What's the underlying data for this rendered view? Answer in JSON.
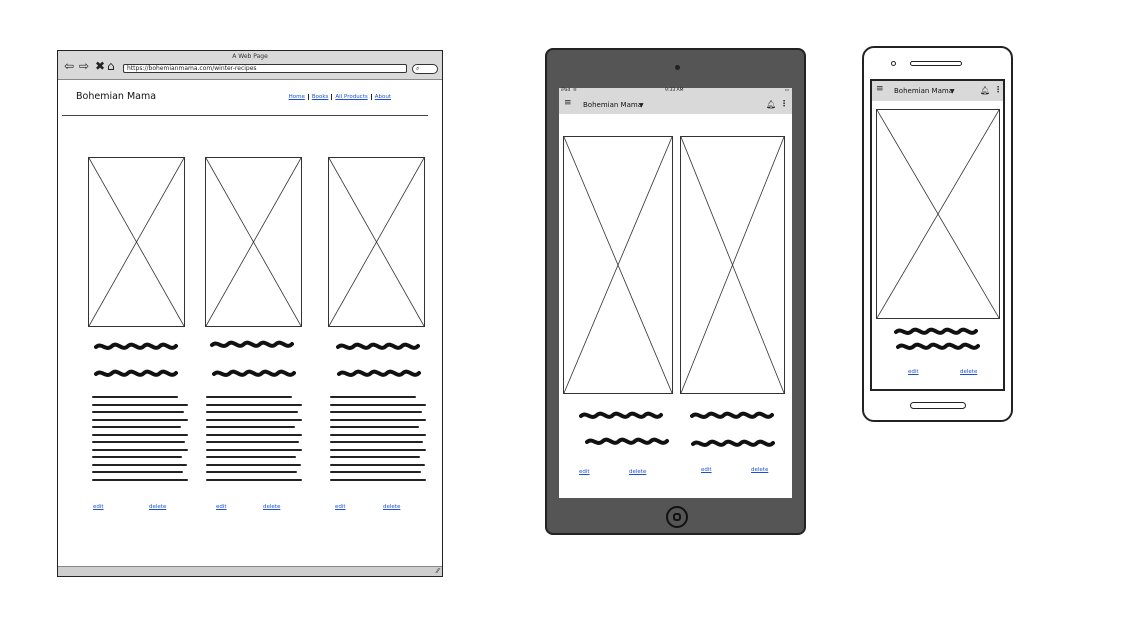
{
  "browser": {
    "window_title": "A Web Page",
    "url": "https://bohemianmama.com/winter-recipes",
    "brand": "Bohemian Mama",
    "nav": [
      "Home",
      "Books",
      "All Products",
      "About"
    ],
    "cards": [
      {
        "edit": "edit",
        "delete": "delete"
      },
      {
        "edit": "edit",
        "delete": "delete"
      },
      {
        "edit": "edit",
        "delete": "delete"
      }
    ]
  },
  "tablet": {
    "status_left": "iPad",
    "status_time": "9:33 AM",
    "app_title": "Bohemian Mama",
    "cards": [
      {
        "edit": "edit",
        "delete": "delete"
      },
      {
        "edit": "edit",
        "delete": "delete"
      }
    ]
  },
  "phone": {
    "app_title": "Bohemian Mama",
    "card": {
      "edit": "edit",
      "delete": "delete"
    }
  },
  "colors": {
    "link": "#1a4fd6",
    "chrome": "#d9d9d9",
    "tablet_body": "#555555"
  },
  "icons": {
    "back": "arrow-left-icon",
    "forward": "arrow-right-icon",
    "close": "close-icon",
    "home": "home-icon",
    "search": "search-icon",
    "menu": "hamburger-icon",
    "bell": "bell-icon",
    "more": "more-vert-icon",
    "dropdown": "caret-down-icon"
  }
}
